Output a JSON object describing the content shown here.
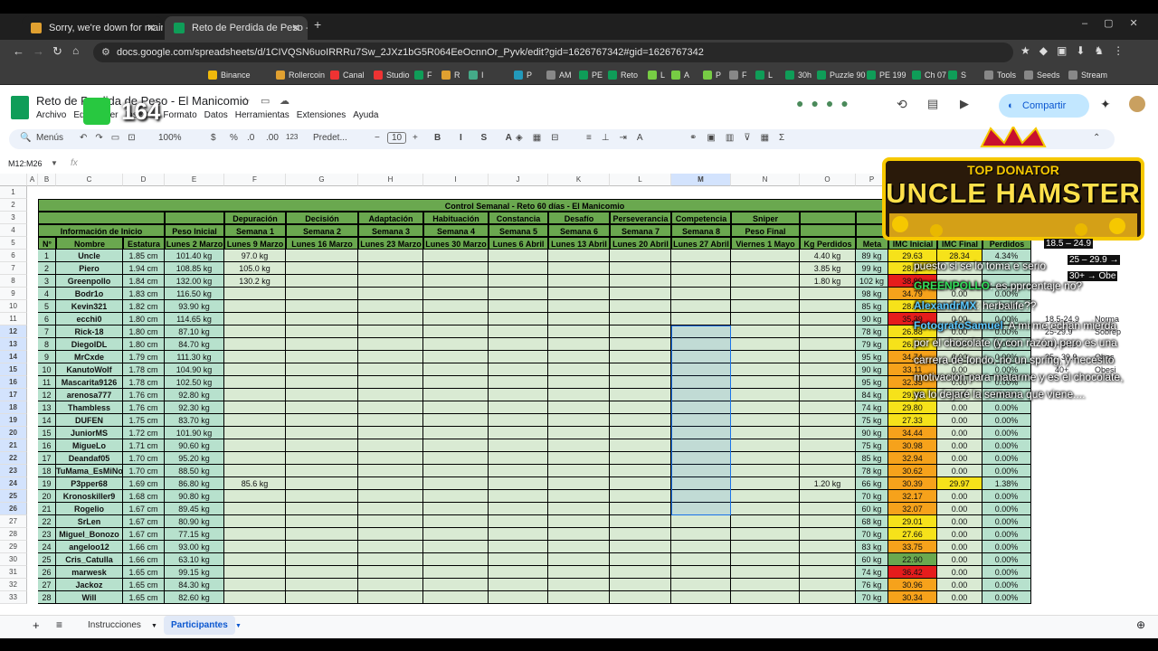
{
  "browser": {
    "tabs": [
      {
        "title": "Sorry, we're down for maintena",
        "active": false
      },
      {
        "title": "Reto de Perdida de Peso - El M",
        "active": true
      }
    ],
    "url": "docs.google.com/spreadsheets/d/1CIVQSN6uoIRRRu7Sw_2JXz1bG5R064EeOcnnOr_Pyvk/edit?gid=1626767342#gid=1626767342",
    "bookmarks": [
      "Binance",
      "Rollercoin",
      "Canal",
      "Studio",
      "F",
      "R",
      "I",
      "P",
      "AM",
      "PE",
      "Reto",
      "L",
      "A",
      "P",
      "F",
      "L",
      "30h",
      "Puzzle 90",
      "PE 199",
      "Ch 07",
      "S",
      "Tools",
      "Seeds",
      "Stream"
    ]
  },
  "sheets": {
    "title": "Reto de Perdida de Peso - El Manicomio",
    "menus": [
      "Archivo",
      "Editar",
      "Ver",
      "Insertar",
      "Formato",
      "Datos",
      "Herramientas",
      "Extensiones",
      "Ayuda"
    ],
    "share_label": "Compartir",
    "menus_label": "Menús",
    "zoom": "100%",
    "currency": "$",
    "percent": "%",
    "dec_less": ".0",
    "dec_more": ".00",
    "number_fmt": "123",
    "font": "Predet...",
    "font_size": "10",
    "name_box": "M12:M26",
    "fx": "fx",
    "sheet_tabs": [
      "Instrucciones",
      "Participantes"
    ],
    "active_sheet": "Participantes"
  },
  "overlay": {
    "badge_number": "164",
    "donor_top": "TOP DONATOR",
    "donor_name": "UNCLE HAMSTER",
    "chat": [
      {
        "user": "",
        "text": "puesto si se lo toma e serio"
      },
      {
        "user": "GREENPOLLO",
        "text": ": es pprcentaje no?"
      },
      {
        "user": "AlexandrMX",
        "text": ": herbalife??"
      },
      {
        "user": "FotografoSamuel",
        "text": ": A mi me echan mierda por el chocolate (y con razón) pero es una carrera de fondo, no un spring, y necesito motivación para matarme y es el chocolate, ya lo dejaré la semana que viene...."
      }
    ],
    "bmi_ranges": [
      "18.5 – 24.9",
      "25 – 29.9 →",
      "30+ → Obe",
      "18.5-24.9",
      "25-29.9",
      "30 - 34.9",
      "35 - 39.9",
      "40+"
    ],
    "bmi_labels": [
      "Norma",
      "Sobrep",
      "Obes",
      "Obesi"
    ]
  },
  "table": {
    "columns": [
      "A",
      "B",
      "C",
      "D",
      "E",
      "F",
      "G",
      "H",
      "I",
      "J",
      "K",
      "L",
      "M",
      "N",
      "O",
      "P",
      "Q",
      "R",
      "S"
    ],
    "title": "Control Semanal - Reto 60 días - El Manicomio",
    "group_info": "Información de Inicio",
    "peso_inicial": "Peso Inicial",
    "phases": [
      "Depuración",
      "Decisión",
      "Adaptación",
      "Habituación",
      "Constancia",
      "Desafío",
      "Perseverancia",
      "Competencia",
      "Sniper"
    ],
    "weeks": [
      "Semana 1",
      "Semana 2",
      "Semana 3",
      "Semana 4",
      "Semana 5",
      "Semana 6",
      "Semana 7",
      "Semana 8",
      "Peso Final"
    ],
    "col_headers": [
      "N°",
      "Nombre",
      "Estatura",
      "Lunes 2 Marzo",
      "Lunes 9 Marzo",
      "Lunes 16 Marzo",
      "Lunes 23 Marzo",
      "Lunes 30 Marzo",
      "Lunes 6 Abril",
      "Lunes 13 Abril",
      "Lunes 20 Abril",
      "Lunes 27 Abril",
      "Viernes 1 Mayo",
      "Kg Perdidos",
      "Meta",
      "IMC Inicial",
      "IMC Final",
      "Perdidos"
    ],
    "ind_label": "Ind",
    "rows": [
      {
        "n": "1",
        "name": "Uncle",
        "h": "1.85 cm",
        "p0": "101.40 kg",
        "w1": "97.0 kg",
        "kg": "4.40 kg",
        "meta": "89 kg",
        "imci": "29.63",
        "imcf": "28.34",
        "pct": "4.34%"
      },
      {
        "n": "2",
        "name": "Piero",
        "h": "1.94 cm",
        "p0": "108.85 kg",
        "w1": "105.0 kg",
        "kg": "3.85 kg",
        "meta": "99 kg",
        "imci": "28.92",
        "imcf": "",
        "pct": ""
      },
      {
        "n": "3",
        "name": "Greenpollo",
        "h": "1.84 cm",
        "p0": "132.00 kg",
        "w1": "130.2 kg",
        "kg": "1.80 kg",
        "meta": "102 kg",
        "imci": "38.99",
        "imcf": "",
        "pct": ""
      },
      {
        "n": "4",
        "name": "Bodr1o",
        "h": "1.83 cm",
        "p0": "116.50 kg",
        "w1": "",
        "kg": "",
        "meta": "98 kg",
        "imci": "34.79",
        "imcf": "0.00",
        "pct": "0.00%"
      },
      {
        "n": "5",
        "name": "Kevin321",
        "h": "1.82 cm",
        "p0": "93.90 kg",
        "w1": "",
        "kg": "",
        "meta": "85 kg",
        "imci": "28.35",
        "imcf": "0.00",
        "pct": "0.00%"
      },
      {
        "n": "6",
        "name": "ecchi0",
        "h": "1.80 cm",
        "p0": "114.65 kg",
        "w1": "",
        "kg": "",
        "meta": "90 kg",
        "imci": "35.39",
        "imcf": "0.00",
        "pct": "0.00%"
      },
      {
        "n": "7",
        "name": "Rick-18",
        "h": "1.80 cm",
        "p0": "87.10 kg",
        "w1": "",
        "kg": "",
        "meta": "78 kg",
        "imci": "26.88",
        "imcf": "0.00",
        "pct": "0.00%"
      },
      {
        "n": "8",
        "name": "DiegolDL",
        "h": "1.80 cm",
        "p0": "84.70 kg",
        "w1": "",
        "kg": "",
        "meta": "79 kg",
        "imci": "26.14",
        "imcf": "0.00",
        "pct": "0.00%"
      },
      {
        "n": "9",
        "name": "MrCxde",
        "h": "1.79 cm",
        "p0": "111.30 kg",
        "w1": "",
        "kg": "",
        "meta": "95 kg",
        "imci": "34.74",
        "imcf": "0.00",
        "pct": "0.00%"
      },
      {
        "n": "10",
        "name": "KanutoWolf",
        "h": "1.78 cm",
        "p0": "104.90 kg",
        "w1": "",
        "kg": "",
        "meta": "90 kg",
        "imci": "33.11",
        "imcf": "0.00",
        "pct": "0.00%"
      },
      {
        "n": "11",
        "name": "Mascarita9126",
        "h": "1.78 cm",
        "p0": "102.50 kg",
        "w1": "",
        "kg": "",
        "meta": "95 kg",
        "imci": "32.35",
        "imcf": "0.00",
        "pct": "0.00%"
      },
      {
        "n": "12",
        "name": "arenosa777",
        "h": "1.76 cm",
        "p0": "92.80 kg",
        "w1": "",
        "kg": "",
        "meta": "84 kg",
        "imci": "29.96",
        "imcf": "0.00",
        "pct": "0.00%"
      },
      {
        "n": "13",
        "name": "Thambless",
        "h": "1.76 cm",
        "p0": "92.30 kg",
        "w1": "",
        "kg": "",
        "meta": "74 kg",
        "imci": "29.80",
        "imcf": "0.00",
        "pct": "0.00%"
      },
      {
        "n": "14",
        "name": "DUFEN",
        "h": "1.75 cm",
        "p0": "83.70 kg",
        "w1": "",
        "kg": "",
        "meta": "75 kg",
        "imci": "27.33",
        "imcf": "0.00",
        "pct": "0.00%"
      },
      {
        "n": "15",
        "name": "JuniorMS",
        "h": "1.72 cm",
        "p0": "101.90 kg",
        "w1": "",
        "kg": "",
        "meta": "90 kg",
        "imci": "34.44",
        "imcf": "0.00",
        "pct": "0.00%"
      },
      {
        "n": "16",
        "name": "MigueLo",
        "h": "1.71 cm",
        "p0": "90.60 kg",
        "w1": "",
        "kg": "",
        "meta": "75 kg",
        "imci": "30.98",
        "imcf": "0.00",
        "pct": "0.00%"
      },
      {
        "n": "17",
        "name": "Deandaf05",
        "h": "1.70 cm",
        "p0": "95.20 kg",
        "w1": "",
        "kg": "",
        "meta": "85 kg",
        "imci": "32.94",
        "imcf": "0.00",
        "pct": "0.00%"
      },
      {
        "n": "18",
        "name": "TuMama_EsMiNo",
        "h": "1.70 cm",
        "p0": "88.50 kg",
        "w1": "",
        "kg": "",
        "meta": "78 kg",
        "imci": "30.62",
        "imcf": "0.00",
        "pct": "0.00%"
      },
      {
        "n": "19",
        "name": "P3pper68",
        "h": "1.69 cm",
        "p0": "86.80 kg",
        "w1": "85.6 kg",
        "kg": "1.20 kg",
        "meta": "66 kg",
        "imci": "30.39",
        "imcf": "29.97",
        "pct": "1.38%"
      },
      {
        "n": "20",
        "name": "Kronoskiller9",
        "h": "1.68 cm",
        "p0": "90.80 kg",
        "w1": "",
        "kg": "",
        "meta": "70 kg",
        "imci": "32.17",
        "imcf": "0.00",
        "pct": "0.00%"
      },
      {
        "n": "21",
        "name": "Rogelio",
        "h": "1.67 cm",
        "p0": "89.45 kg",
        "w1": "",
        "kg": "",
        "meta": "60 kg",
        "imci": "32.07",
        "imcf": "0.00",
        "pct": "0.00%"
      },
      {
        "n": "22",
        "name": "SrLen",
        "h": "1.67 cm",
        "p0": "80.90 kg",
        "w1": "",
        "kg": "",
        "meta": "68 kg",
        "imci": "29.01",
        "imcf": "0.00",
        "pct": "0.00%"
      },
      {
        "n": "23",
        "name": "Miguel_Bonozo",
        "h": "1.67 cm",
        "p0": "77.15 kg",
        "w1": "",
        "kg": "",
        "meta": "70 kg",
        "imci": "27.66",
        "imcf": "0.00",
        "pct": "0.00%"
      },
      {
        "n": "24",
        "name": "angeloo12",
        "h": "1.66 cm",
        "p0": "93.00 kg",
        "w1": "",
        "kg": "",
        "meta": "83 kg",
        "imci": "33.75",
        "imcf": "0.00",
        "pct": "0.00%"
      },
      {
        "n": "25",
        "name": "Cris_Catulla",
        "h": "1.66 cm",
        "p0": "63.10 kg",
        "w1": "",
        "kg": "",
        "meta": "60 kg",
        "imci": "22.90",
        "imcf": "0.00",
        "pct": "0.00%"
      },
      {
        "n": "26",
        "name": "marwesk",
        "h": "1.65 cm",
        "p0": "99.15 kg",
        "w1": "",
        "kg": "",
        "meta": "74 kg",
        "imci": "36.42",
        "imcf": "0.00",
        "pct": "0.00%"
      },
      {
        "n": "27",
        "name": "Jackoz",
        "h": "1.65 cm",
        "p0": "84.30 kg",
        "w1": "",
        "kg": "",
        "meta": "76 kg",
        "imci": "30.96",
        "imcf": "0.00",
        "pct": "0.00%"
      },
      {
        "n": "28",
        "name": "Will",
        "h": "1.65 cm",
        "p0": "82.60 kg",
        "w1": "",
        "kg": "",
        "meta": "70 kg",
        "imci": "30.34",
        "imcf": "0.00",
        "pct": "0.00%"
      }
    ]
  },
  "colors": {
    "header_green": "#6aa84f",
    "cell_green": "#b7e1cd",
    "light_green": "#d9ead3",
    "imc_orange": "#f6a21b",
    "imc_red": "#e51c1c",
    "imc_yellow": "#f6e21a"
  }
}
